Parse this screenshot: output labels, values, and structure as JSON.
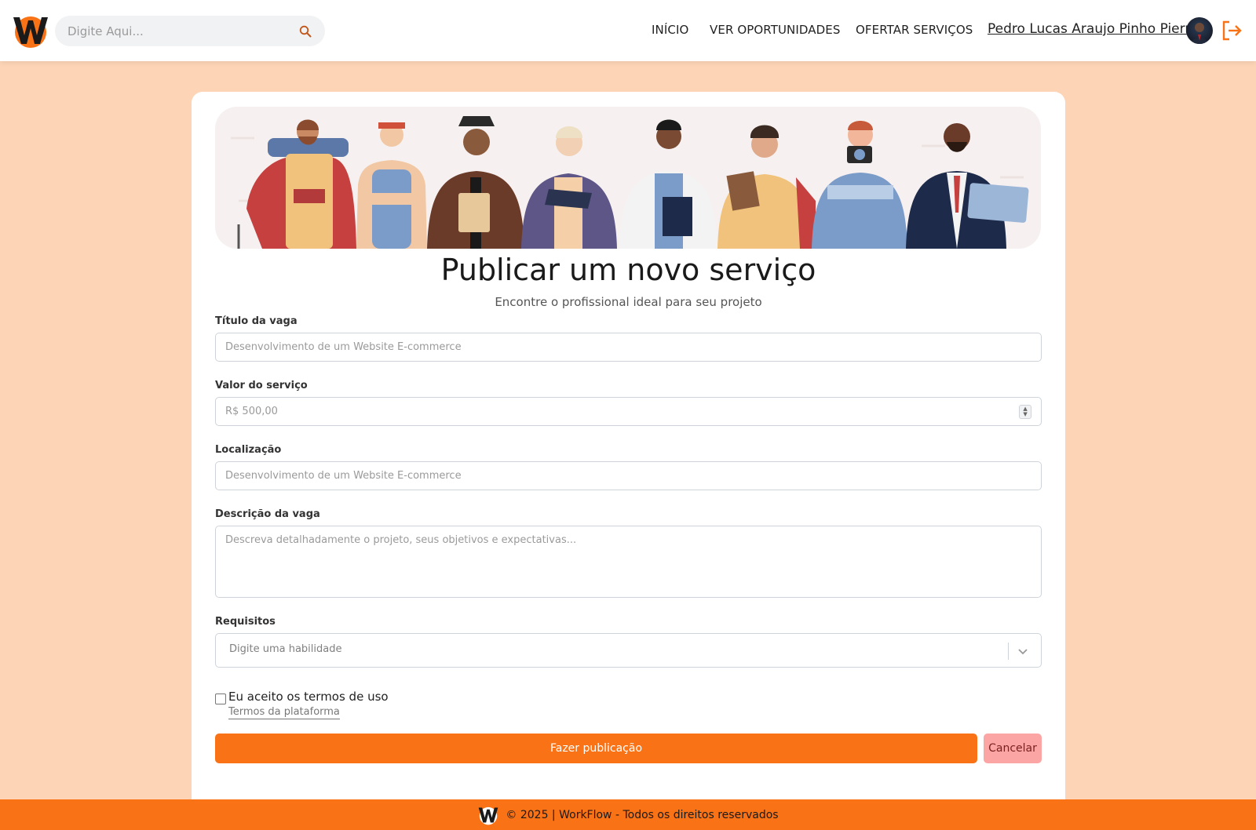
{
  "header": {
    "search_placeholder": "Digite Aqui...",
    "nav": [
      "INÍCIO",
      "VER OPORTUNIDADES",
      "OFERTAR SERVIÇOS"
    ],
    "user_name": "Pedro Lucas Araujo Pinho Pierre",
    "accent_color": "#f97316"
  },
  "main": {
    "title": "Publicar um novo serviço",
    "subtitle": "Encontre o profissional ideal para seu projeto",
    "fields": {
      "titulo": {
        "label": "Título da vaga",
        "placeholder": "Desenvolvimento de um Website E-commerce"
      },
      "valor": {
        "label": "Valor do serviço",
        "placeholder": "R$ 500,00"
      },
      "localizacao": {
        "label": "Localização",
        "placeholder": "Desenvolvimento de um Website E-commerce"
      },
      "descricao": {
        "label": "Descrição da vaga",
        "placeholder": "Descreva detalhadamente o projeto, seus objetivos e expectativas..."
      },
      "requisitos": {
        "label": "Requisitos",
        "placeholder": "Digite uma habilidade"
      }
    },
    "terms": {
      "checkbox_label": "Eu aceito os termos de uso",
      "link": "Termos da plataforma"
    },
    "buttons": {
      "submit": "Fazer publicação",
      "cancel": "Cancelar"
    }
  },
  "footer": {
    "text": "© 2025 | WorkFlow - Todos os direitos reservados"
  }
}
